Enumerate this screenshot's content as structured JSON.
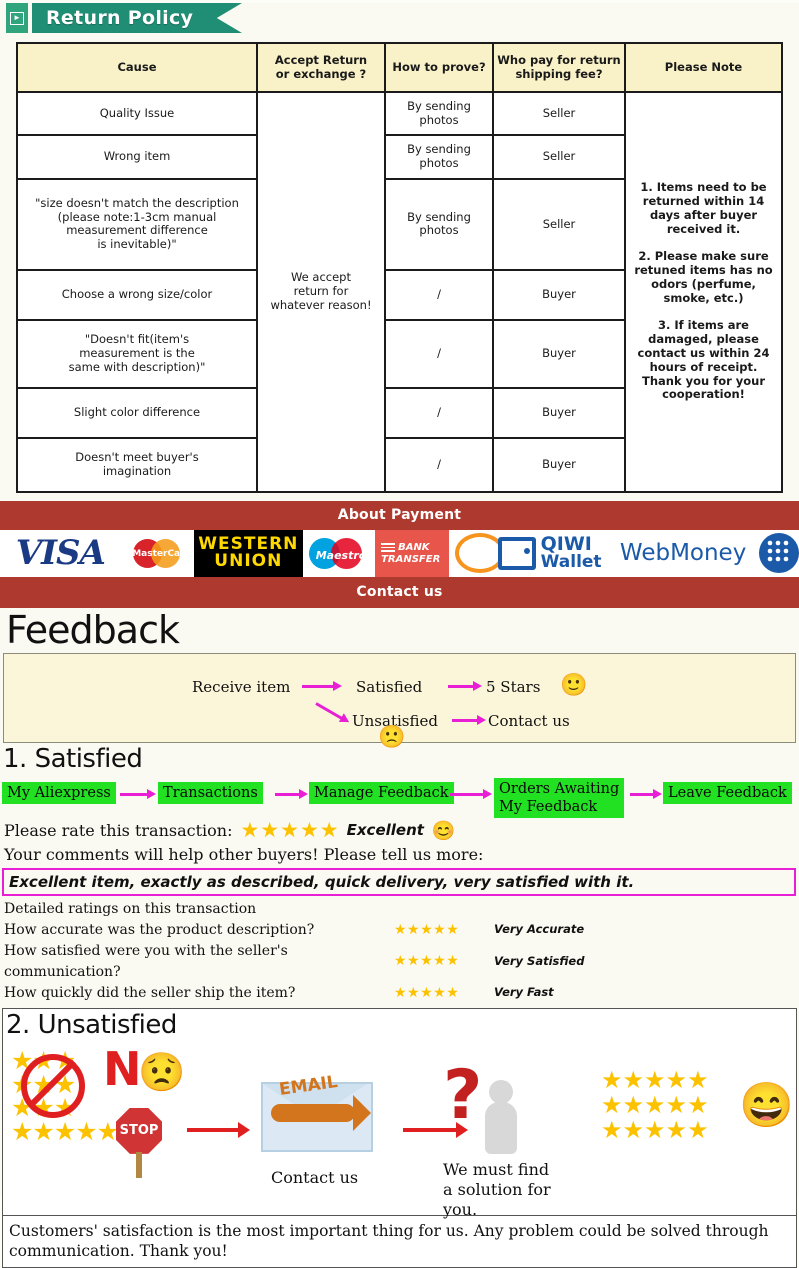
{
  "return_policy": {
    "banner_title": "Return Policy",
    "banner_icon": "mail-forward-icon",
    "columns": [
      "Cause",
      "Accept Return\nor exchange ?",
      "How to prove?",
      "Who pay for return\nshipping fee?",
      "Please Note"
    ],
    "accept_cell": "We accept\nreturn for\nwhatever reason!",
    "note_cell": "1. Items need to be returned within 14 days after buyer received it.\n\n2. Please make sure retuned items has no odors (perfume, smoke, etc.)\n\n3. If items are damaged, please contact us within 24 hours of receipt.\nThank you for your cooperation!",
    "rows": [
      {
        "cause": "Quality Issue",
        "prove": "By sending\nphotos",
        "payer": "Seller"
      },
      {
        "cause": "Wrong item",
        "prove": "By sending\nphotos",
        "payer": "Seller"
      },
      {
        "cause": "\"size doesn't match the description\n(please note:1-3cm manual\nmeasurement difference\nis inevitable)\"",
        "prove": "By sending\nphotos",
        "payer": "Seller"
      },
      {
        "cause": "Choose a wrong size/color",
        "prove": "/",
        "payer": "Buyer"
      },
      {
        "cause": "\"Doesn't fit(item's\nmeasurement is the\nsame with description)\"",
        "prove": "/",
        "payer": "Buyer"
      },
      {
        "cause": "Slight color difference",
        "prove": "/",
        "payer": "Buyer"
      },
      {
        "cause": "Doesn't meet buyer's\nimagination",
        "prove": "/",
        "payer": "Buyer"
      }
    ]
  },
  "payment": {
    "title": "About Payment",
    "contact_title": "Contact us",
    "bar_color": "#ae392e",
    "logos": [
      {
        "name": "visa",
        "text": "VISA"
      },
      {
        "name": "mastercard",
        "text": "MasterCard"
      },
      {
        "name": "western-union",
        "line1": "WESTERN",
        "line2": "UNION"
      },
      {
        "name": "maestro",
        "text": "Maestro"
      },
      {
        "name": "bank-transfer",
        "line1": "BANK",
        "line2": "TRANSFER"
      },
      {
        "name": "qiwi-wallet",
        "line1": "QIWI",
        "line2": "Wallet"
      },
      {
        "name": "webmoney",
        "text": "WebMoney"
      }
    ]
  },
  "feedback": {
    "title": "Feedback",
    "flow": {
      "receive": "Receive item",
      "satisfied": "Satisfied",
      "five_stars": "5 Stars",
      "unsatisfied": "Unsatisfied",
      "contact": "Contact us",
      "smile": "🙂",
      "frown": "🙁"
    }
  },
  "satisfied": {
    "heading": "1. Satisfied",
    "steps": [
      "My Aliexpress",
      "Transactions",
      "Manage Feedback",
      "Orders Awaiting\nMy Feedback",
      "Leave Feedback"
    ],
    "rate_label": "Please rate this transaction:",
    "rate_stars": "★★★★★",
    "rate_word": "Excellent",
    "rate_emoji": "😊",
    "comments_prompt": "Your comments will help other buyers! Please tell us more:",
    "comment_text": "Excellent item, exactly as described, quick delivery, very satisfied with it.",
    "comment_border_color": "#e81fd4",
    "detail_heading": "Detailed ratings on this transaction",
    "detail_rows": [
      {
        "question": "How accurate was the product description?",
        "stars": "★★★★★",
        "label": "Very Accurate"
      },
      {
        "question": "How satisfied were you with the seller's communication?",
        "stars": "★★★★★",
        "label": "Very Satisfied"
      },
      {
        "question": "How quickly did the seller ship the item?",
        "stars": "★★★★★",
        "label": "Very Fast"
      }
    ]
  },
  "unsatisfied": {
    "heading": "2. Unsatisfied",
    "no_letter": "N",
    "no_face": "😟",
    "stop_label": "STOP",
    "bad_stars_rows": [
      "★★★",
      "★★★",
      "★★★",
      "★★★★★"
    ],
    "email_label": "EMAIL",
    "contact_caption": "Contact us",
    "question_mark": "?",
    "solution_caption": "We must find\na solution for\nyou.",
    "good_stars_rows": [
      "★★★★★",
      "★★★★★",
      "★★★★★"
    ],
    "final_smile": "😄",
    "footer": "Customers' satisfaction is the most important thing for us. Any problem could be solved through communication. Thank you!"
  }
}
